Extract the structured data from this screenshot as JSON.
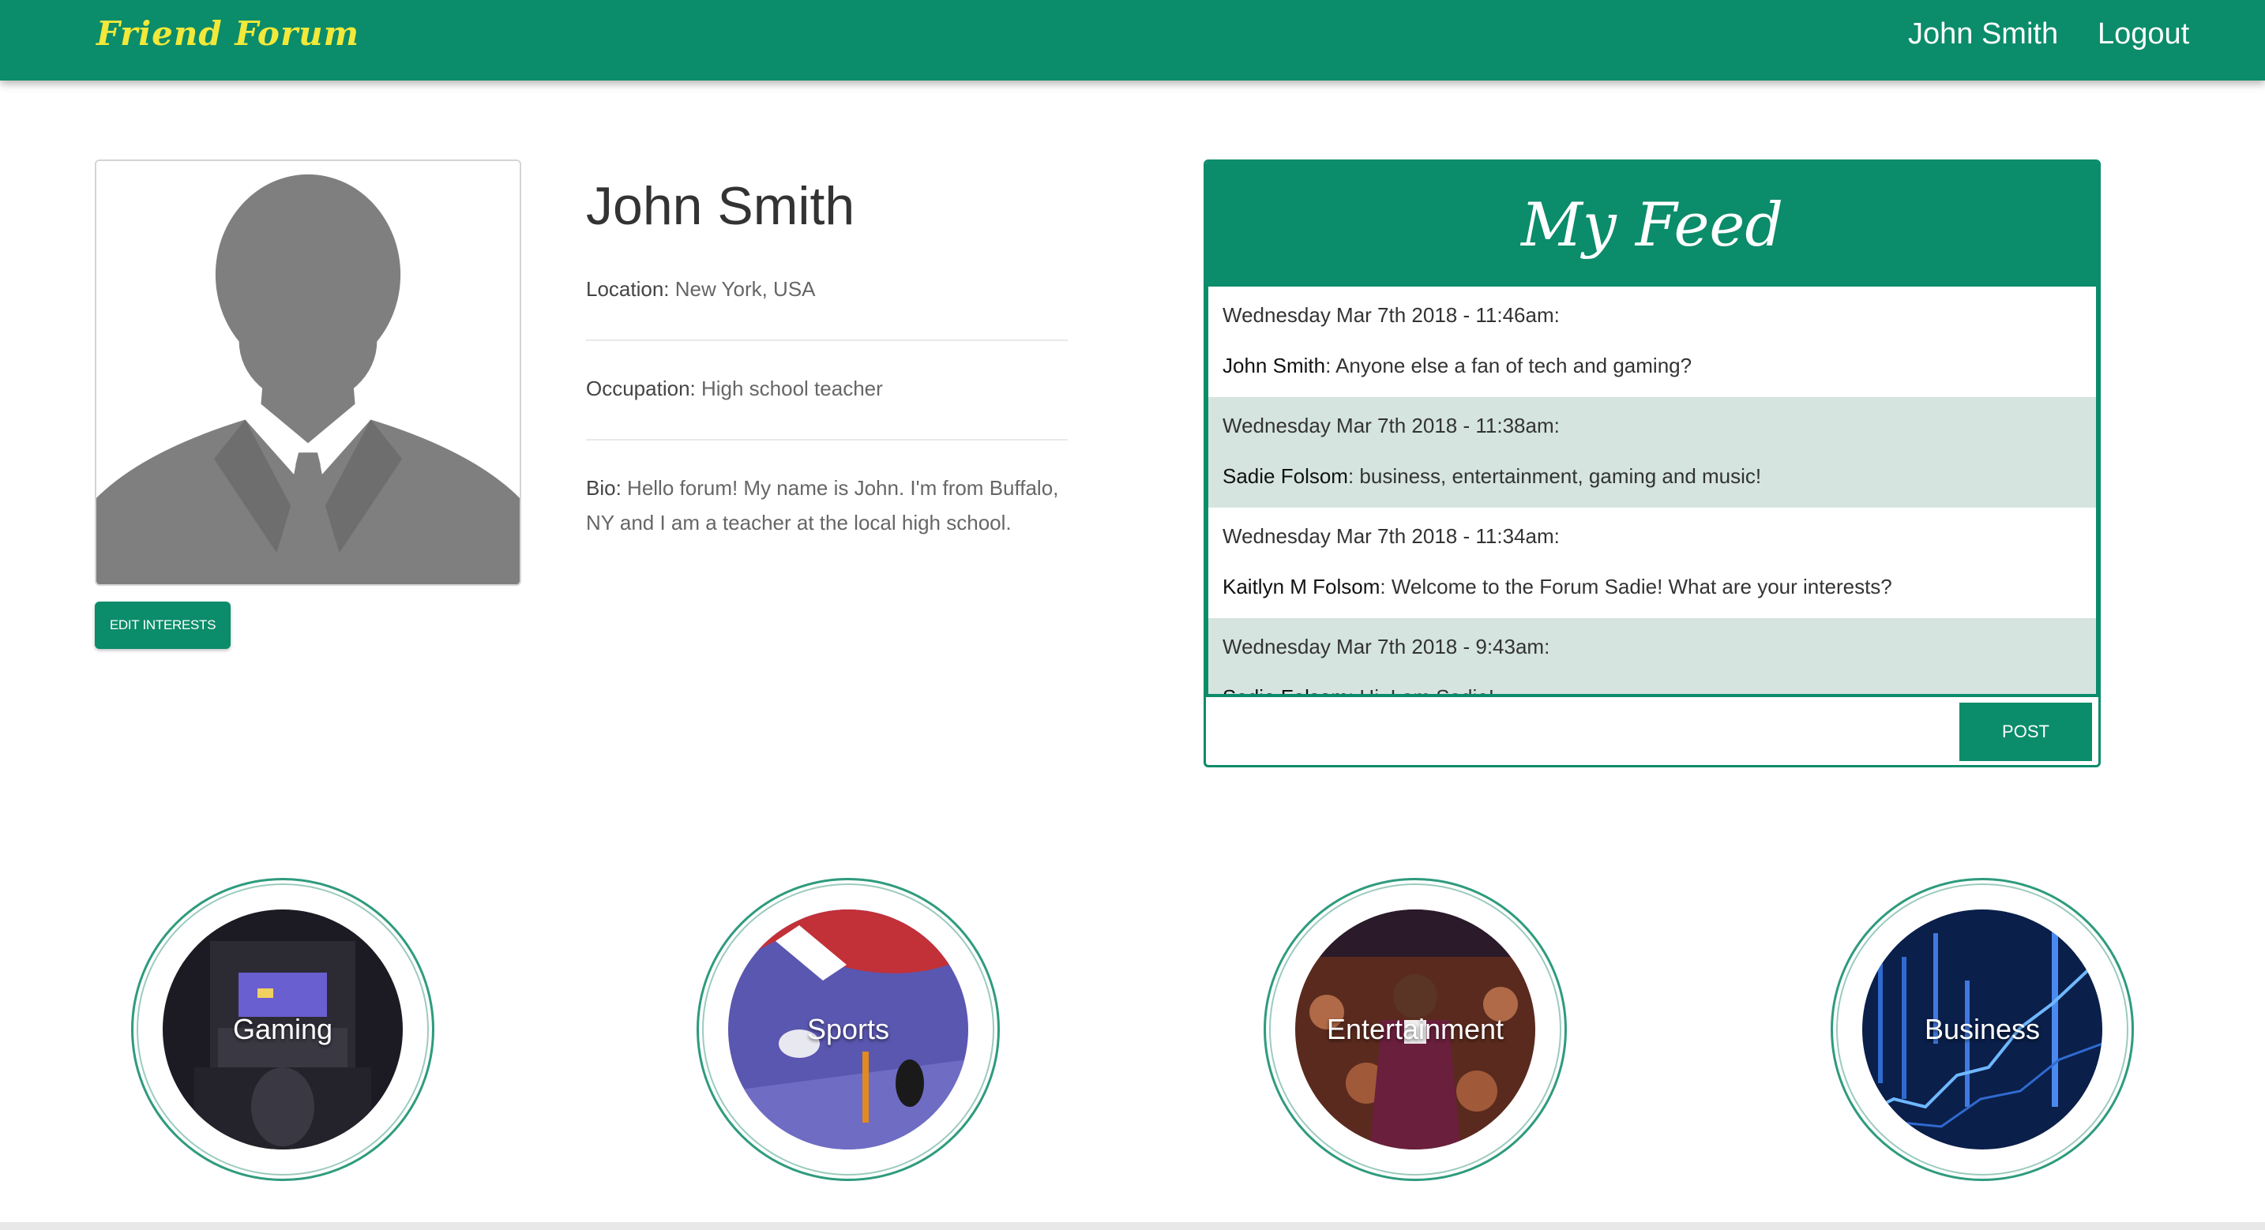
{
  "navbar": {
    "brand": "Friend Forum",
    "user_link": "John Smith",
    "logout_link": "Logout"
  },
  "profile": {
    "name": "John Smith",
    "location_label": "Location:",
    "location_value": "New York, USA",
    "occupation_label": "Occupation:",
    "occupation_value": "High school teacher",
    "bio_label": "Bio:",
    "bio_value": "Hello forum! My name is John. I'm from Buffalo, NY and I am a teacher at the local high school.",
    "edit_button": "EDIT INTERESTS"
  },
  "feed": {
    "title": "My Feed",
    "posts": [
      {
        "time": "Wednesday Mar 7th 2018 - 11:46am:",
        "author": "John Smith",
        "message": "Anyone else a fan of tech and gaming?"
      },
      {
        "time": "Wednesday Mar 7th 2018 - 11:38am:",
        "author": "Sadie Folsom",
        "message": "business, entertainment, gaming and music!"
      },
      {
        "time": "Wednesday Mar 7th 2018 - 11:34am:",
        "author": "Kaitlyn M Folsom",
        "message": "Welcome to the Forum Sadie! What are your interests?"
      },
      {
        "time": "Wednesday Mar 7th 2018 - 9:43am:",
        "author": "Sadie Folsom",
        "message": "Hi, I am Sadie!"
      }
    ],
    "input_value": "",
    "post_button": "POST"
  },
  "interests": [
    {
      "label": "Gaming"
    },
    {
      "label": "Sports"
    },
    {
      "label": "Entertainment"
    },
    {
      "label": "Business"
    }
  ],
  "colors": {
    "brand_green": "#0b8c6a",
    "brand_yellow": "#f2e93a",
    "feed_alt_row": "#d5e4df"
  }
}
